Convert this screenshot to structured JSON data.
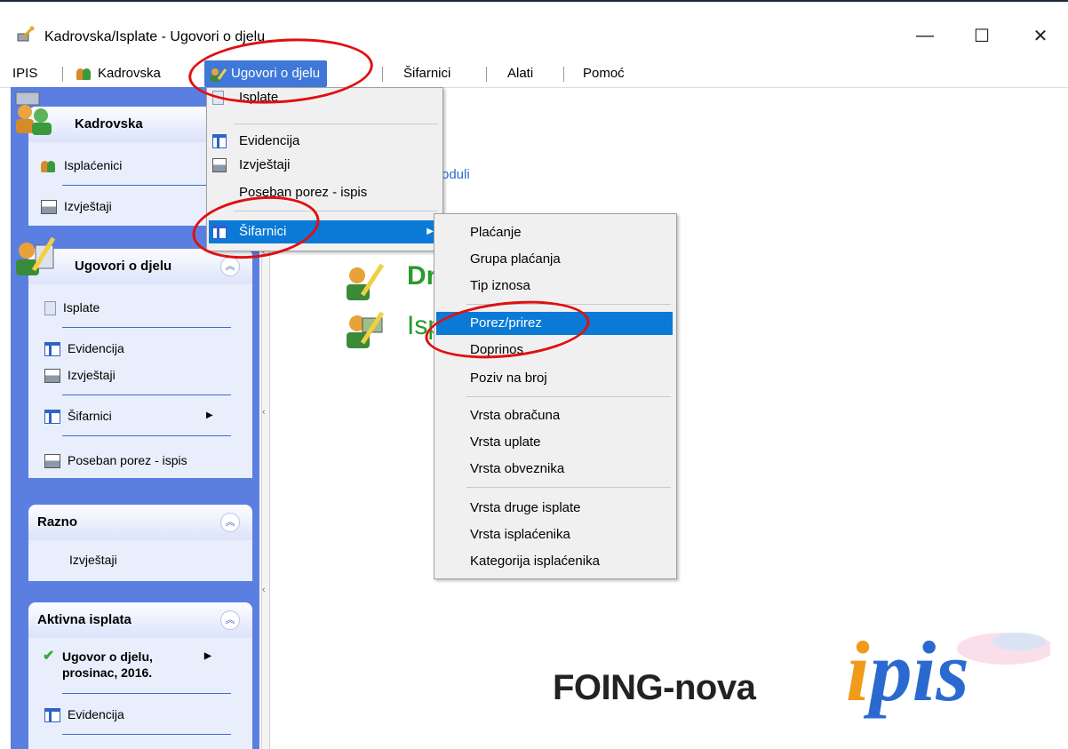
{
  "window": {
    "title": "Kadrovska/Isplate - Ugovori o djelu",
    "minimize": "—",
    "maximize": "☐",
    "close": "✕"
  },
  "menubar": {
    "items": [
      "IPIS",
      "Kadrovska",
      "Ugovori o djelu",
      "Šifarnici",
      "Alati",
      "Pomoć"
    ]
  },
  "dropdown": {
    "items": [
      "Isplate",
      "Evidencija",
      "Izvještaji",
      "Poseban porez - ispis",
      "Šifarnici"
    ]
  },
  "submenu": {
    "items": [
      "Plaćanje",
      "Grupa plaćanja",
      "Tip iznosa",
      "Porez/prirez",
      "Doprinos",
      "Poziv na broj",
      "Vrsta obračuna",
      "Vrsta uplate",
      "Vrsta obveznika",
      "Vrsta druge isplate",
      "Vrsta isplaćenika",
      "Kategorija isplaćenika"
    ],
    "highlighted": "Porez/prirez"
  },
  "sidebar": {
    "kadrovska": {
      "title": "Kadrovska",
      "items": [
        "Isplaćenici",
        "Izvještaji"
      ]
    },
    "ugovori": {
      "title": "Ugovori o djelu",
      "items": [
        "Isplate",
        "Evidencija",
        "Izvještaji",
        "Šifarnici",
        "Poseban porez - ispis"
      ]
    },
    "razno": {
      "title": "Razno",
      "items": [
        "Izvještaji"
      ]
    },
    "aktivna": {
      "title": "Aktivna isplata",
      "item_line1": "Ugovor o djelu,",
      "item_line2": "prosinac, 2016.",
      "items": [
        "Evidencija"
      ]
    }
  },
  "content": {
    "link_fragment": "oduli",
    "item1_fragment": "Dr",
    "item2_fragment": "Isp"
  },
  "logo": {
    "company": "FOING-nova",
    "product": "ipis"
  },
  "colors": {
    "sidebar": "#5a7fe0",
    "highlight": "#0a7ad6",
    "annotation": "#e01010",
    "logo_i": "#f29a1a",
    "logo_pis": "#2a6ad0"
  }
}
